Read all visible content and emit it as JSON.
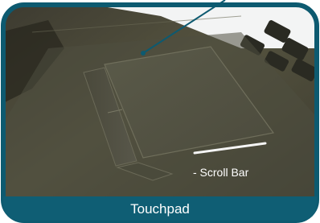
{
  "photo": {
    "subject": "laptop-touchpad-closeup",
    "colors": {
      "frame_border": "#0d5a70",
      "caption_bar": "#0f5e74",
      "callout_line": "#0d5a70",
      "highlight_bar": "#f2f2f2"
    }
  },
  "annotations": {
    "scroll_bar_label": "- Scroll Bar"
  },
  "caption": {
    "text": "Touchpad"
  }
}
